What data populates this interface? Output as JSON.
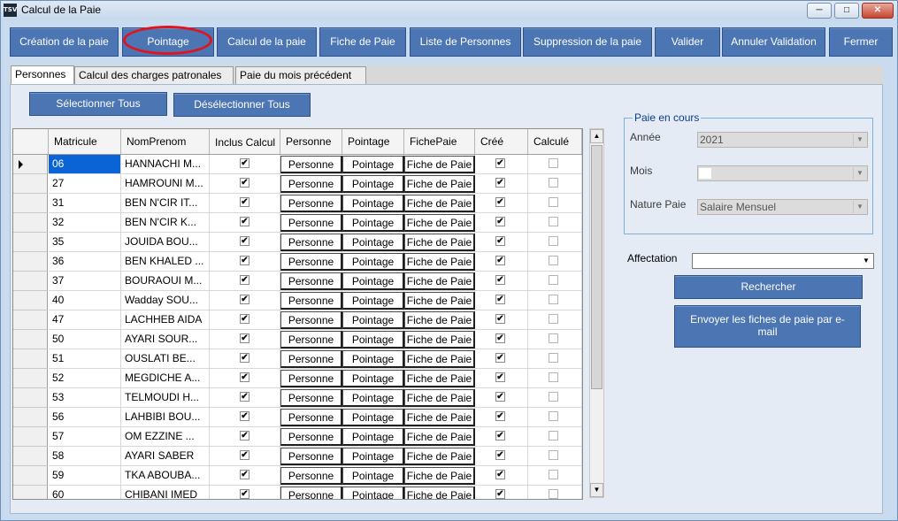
{
  "window": {
    "title": "Calcul de la Paie",
    "app_icon_text": "TSV",
    "minimize_glyph": "─",
    "maximize_glyph": "□",
    "close_glyph": "✕"
  },
  "toolbar": {
    "creation": "Création de la paie",
    "pointage": "Pointage",
    "calcul": "Calcul de la paie",
    "fiche": "Fiche de Paie",
    "liste": "Liste de Personnes",
    "suppression": "Suppression de la paie",
    "valider": "Valider",
    "annuler": "Annuler Validation",
    "fermer": "Fermer"
  },
  "tabs": [
    "Personnes",
    "Calcul des charges patronales",
    "Paie du mois précédent"
  ],
  "selection": {
    "select_all": "Sélectionner Tous",
    "deselect_all": "Désélectionner Tous"
  },
  "grid": {
    "columns": [
      "Matricule",
      "NomPrenom",
      "Inclus Calcul",
      "Personne",
      "Pointage",
      "FichePaie",
      "Créé",
      "Calculé"
    ],
    "button_labels": {
      "personne": "Personne",
      "pointage": "Pointage",
      "fiche": "Fiche de Paie"
    },
    "rows": [
      {
        "matricule": "06",
        "nom": "HANNACHI  M...",
        "inclus": true,
        "cree": true,
        "calcule": false
      },
      {
        "matricule": "27",
        "nom": "HAMROUNI  M...",
        "inclus": true,
        "cree": true,
        "calcule": false
      },
      {
        "matricule": "31",
        "nom": "BEN N'CIR  IT...",
        "inclus": true,
        "cree": true,
        "calcule": false
      },
      {
        "matricule": "32",
        "nom": "BEN N'CIR  K...",
        "inclus": true,
        "cree": true,
        "calcule": false
      },
      {
        "matricule": "35",
        "nom": "JOUIDA  BOU...",
        "inclus": true,
        "cree": true,
        "calcule": false
      },
      {
        "matricule": "36",
        "nom": "BEN KHALED  ...",
        "inclus": true,
        "cree": true,
        "calcule": false
      },
      {
        "matricule": "37",
        "nom": "BOURAOUI  M...",
        "inclus": true,
        "cree": true,
        "calcule": false
      },
      {
        "matricule": "40",
        "nom": "Wadday  SOU...",
        "inclus": true,
        "cree": true,
        "calcule": false
      },
      {
        "matricule": "47",
        "nom": "LACHHEB  AIDA",
        "inclus": true,
        "cree": true,
        "calcule": false
      },
      {
        "matricule": "50",
        "nom": "AYARI  SOUR...",
        "inclus": true,
        "cree": true,
        "calcule": false
      },
      {
        "matricule": "51",
        "nom": "OUSLATI   BE...",
        "inclus": true,
        "cree": true,
        "calcule": false
      },
      {
        "matricule": "52",
        "nom": "MEGDICHE  A...",
        "inclus": true,
        "cree": true,
        "calcule": false
      },
      {
        "matricule": "53",
        "nom": "TELMOUDI  H...",
        "inclus": true,
        "cree": true,
        "calcule": false
      },
      {
        "matricule": "56",
        "nom": "LAHBIBI  BOU...",
        "inclus": true,
        "cree": true,
        "calcule": false
      },
      {
        "matricule": "57",
        "nom": "OM EZZINE  ...",
        "inclus": true,
        "cree": true,
        "calcule": false
      },
      {
        "matricule": "58",
        "nom": "AYARI  SABER",
        "inclus": true,
        "cree": true,
        "calcule": false
      },
      {
        "matricule": "59",
        "nom": "TKA  ABOUBA...",
        "inclus": true,
        "cree": true,
        "calcule": false
      },
      {
        "matricule": "60",
        "nom": "CHIBANI  IMED",
        "inclus": true,
        "cree": true,
        "calcule": false
      }
    ]
  },
  "paie_en_cours": {
    "legend": "Paie en cours",
    "annee_label": "Année",
    "annee_value": "2021",
    "mois_label": "Mois",
    "mois_value": "",
    "nature_label": "Nature Paie",
    "nature_value": "Salaire Mensuel"
  },
  "affectation": {
    "label": "Affectation",
    "value": ""
  },
  "actions": {
    "rechercher": "Rechercher",
    "envoyer": "Envoyer les fiches de paie par e-mail"
  },
  "glyphs": {
    "check": "✔",
    "arrow_up": "▲",
    "arrow_down": "▼"
  },
  "colors": {
    "button_blue": "#4b75b3",
    "selection_blue": "#0a64d6",
    "highlight_red": "#e0141e"
  }
}
